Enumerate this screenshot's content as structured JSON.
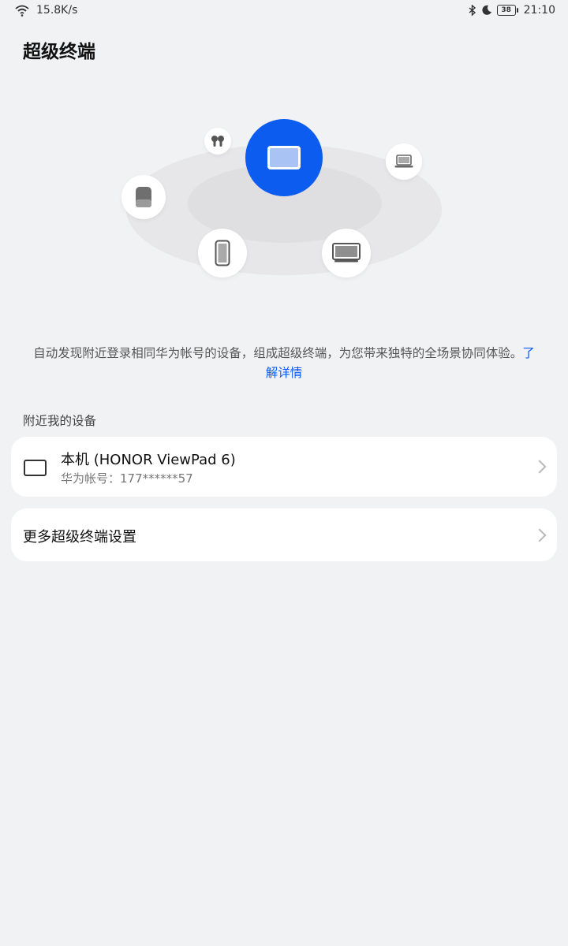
{
  "status_bar": {
    "network_speed": "15.8K/s",
    "battery": "38",
    "time": "21:10",
    "icons": [
      "wifi-icon",
      "bluetooth-icon",
      "moon-icon",
      "battery-icon"
    ]
  },
  "page": {
    "title": "超级终端"
  },
  "hero": {
    "devices": [
      "tablet",
      "earbuds",
      "speaker",
      "laptop",
      "phone",
      "tv"
    ],
    "accent_color": "#0d5cf0"
  },
  "description": {
    "text": "自动发现附近登录相同华为帐号的设备，组成超级终端，为您带来独特的全场景协同体验。",
    "link": "了解详情"
  },
  "nearby": {
    "section_label": "附近我的设备",
    "device": {
      "name": "本机 (HONOR ViewPad 6)",
      "account": "华为帐号：177******57"
    }
  },
  "more_settings": {
    "label": "更多超级终端设置"
  }
}
